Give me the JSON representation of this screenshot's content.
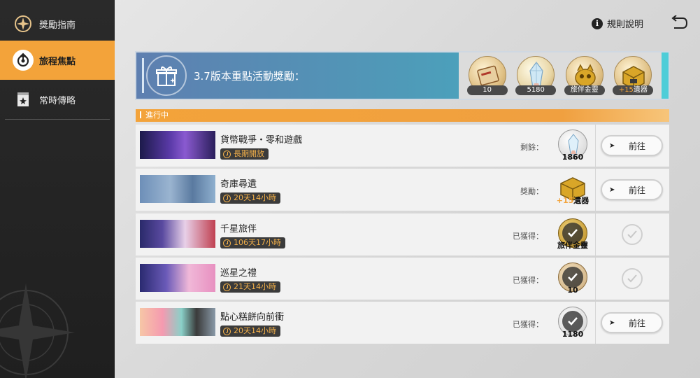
{
  "sidebar": {
    "items": [
      {
        "label": "獎勵指南",
        "icon": "compass-icon"
      },
      {
        "label": "旅程焦點",
        "icon": "focus-icon",
        "active": true
      },
      {
        "label": "常時傳略",
        "icon": "bookmark-icon"
      }
    ]
  },
  "header": {
    "help_label": "規則說明",
    "help_icon": "info-icon",
    "back_icon": "back-arrow-icon"
  },
  "banner": {
    "title": "3.7版本重點活動獎勵：",
    "rewards": [
      {
        "qty": "10",
        "icon": "ticket-icon"
      },
      {
        "qty": "5180",
        "icon": "crystal-icon"
      },
      {
        "qty": "旅伴金靈",
        "icon": "golden-companion-icon"
      },
      {
        "qty_plus": "+15",
        "qty": "遺器",
        "icon": "relic-box-icon"
      }
    ]
  },
  "list": {
    "header": "進行中",
    "rows": [
      {
        "name": "貨幣戰爭・零和遊戲",
        "badge": "長期開放",
        "label": "剩餘：",
        "reward_qty": "1860",
        "reward_plus": "",
        "claimed": false,
        "button": "前往"
      },
      {
        "name": "奇庫尋遺",
        "badge": "20天14小時",
        "label": "獎勵：",
        "reward_qty": "遺器",
        "reward_plus": "+15",
        "claimed": false,
        "button": "前往"
      },
      {
        "name": "千星旅伴",
        "badge": "106天17小時",
        "label": "已獲得：",
        "reward_qty": "旅伴金靈",
        "reward_plus": "",
        "claimed": true,
        "button": ""
      },
      {
        "name": "巡星之禮",
        "badge": "21天14小時",
        "label": "已獲得：",
        "reward_qty": "10",
        "reward_plus": "",
        "claimed": true,
        "button": ""
      },
      {
        "name": "點心糕餅向前衝",
        "badge": "20天14小時",
        "label": "已獲得：",
        "reward_qty": "1180",
        "reward_plus": "",
        "claimed": false,
        "button": "前往"
      }
    ]
  },
  "colors": {
    "accent": "#f3a33a",
    "sidebar_bg": "#242424",
    "banner_start": "#5e7fb0",
    "banner_end": "#3fb6c8"
  }
}
